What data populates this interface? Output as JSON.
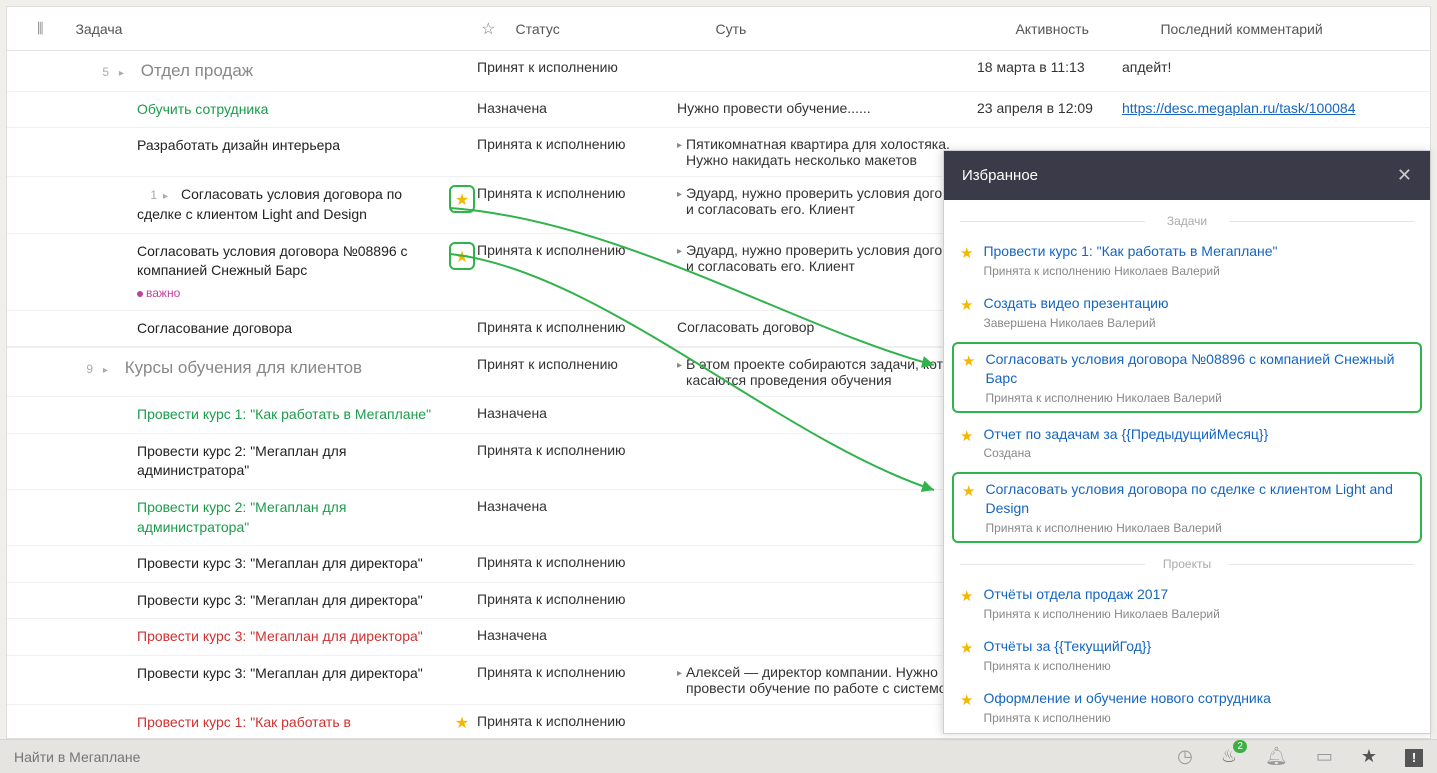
{
  "header": {
    "task": "Задача",
    "status": "Статус",
    "essence": "Суть",
    "activity": "Активность",
    "comment": "Последний комментарий"
  },
  "groups": [
    {
      "count": "5",
      "title": "Отдел продаж",
      "status": "Принят к исполнению",
      "activity": "18 марта в 11:13",
      "comment": "апдейт!"
    }
  ],
  "rows": [
    {
      "indent": 2,
      "title": "Обучить сотрудника",
      "color": "green",
      "status": "Назначена",
      "essence": "Нужно провести обучение......",
      "activity": "23 апреля в 12:09",
      "comment_link": "https://desc.megaplan.ru/task/100084"
    },
    {
      "indent": 2,
      "title": "Разработать дизайн интерьера",
      "color": "black",
      "status": "Принята к исполнению",
      "essence": "Пятикомнатная квартира для холостяка. Нужно накидать несколько макетов",
      "essence_tri": true
    },
    {
      "indent": 2,
      "count": "1",
      "caret": true,
      "title": "Согласовать условия договора по сделке с клиентом Light and Design",
      "color": "black",
      "star": true,
      "status": "Принята к исполнению",
      "essence": "Эдуард, нужно проверить условия договора и согласовать его. Клиент",
      "essence_tri": true
    },
    {
      "indent": 2,
      "title": "Согласовать условия договора №08896 с компанией Снежный Барс",
      "color": "black",
      "tag": "важно",
      "star": true,
      "status": "Принята к исполнению",
      "essence": "Эдуард, нужно проверить условия договора и согласовать его. Клиент",
      "essence_tri": true
    },
    {
      "indent": 2,
      "title": "Согласование договора",
      "color": "black",
      "status": "Принята к исполнению",
      "essence": "Согласовать договор"
    }
  ],
  "group2": {
    "count": "9",
    "title": "Курсы обучения для клиентов",
    "status": "Принят к исполнению",
    "essence": "В этом проекте собираются задачи, которые касаются проведения обучения",
    "essence_tri": true
  },
  "rows2": [
    {
      "title": "Провести курс 1: \"Как работать в Мегаплане\"",
      "color": "green",
      "status": "Назначена"
    },
    {
      "title": "Провести курс 2: \"Мегаплан для администратора\"",
      "color": "black",
      "status": "Принята к исполнению"
    },
    {
      "title": "Провести курс 2: \"Мегаплан для администратора\"",
      "color": "green",
      "status": "Назначена"
    },
    {
      "title": "Провести курс 3: \"Мегаплан для директора\"",
      "color": "black",
      "status": "Принята к исполнению"
    },
    {
      "title": "Провести курс 3: \"Мегаплан для директора\"",
      "color": "black",
      "status": "Принята к исполнению"
    },
    {
      "title": "Провести курс 3: \"Мегаплан для директора\"",
      "color": "red",
      "status": "Назначена"
    },
    {
      "title": "Провести курс 3: \"Мегаплан для директора\"",
      "color": "black",
      "status": "Принята к исполнению",
      "essence": "Алексей — директор компании. Нужно провести обучение по работе с системой",
      "essence_tri": true
    },
    {
      "title": "Провести курс 1: \"Как работать в",
      "color": "red",
      "star_small": true,
      "status": "Принята к исполнению"
    }
  ],
  "favorites": {
    "title": "Избранное",
    "section_tasks": "Задачи",
    "section_projects": "Проекты",
    "tasks": [
      {
        "title": "Провести курс 1: \"Как работать в Мегаплане\"",
        "meta": "Принята к исполнению Николаев Валерий"
      },
      {
        "title": "Создать видео презентацию",
        "meta": "Завершена Николаев Валерий"
      },
      {
        "title": "Согласовать условия договора №08896 с компанией Снежный Барс",
        "meta": "Принята к исполнению Николаев Валерий",
        "highlight": true
      },
      {
        "title": "Отчет по задачам за {{ПредыдущийМесяц}}",
        "meta": "Создана"
      },
      {
        "title": "Согласовать условия договора по сделке с клиентом Light and Design",
        "meta": "Принята к исполнению Николаев Валерий",
        "highlight": true
      }
    ],
    "projects": [
      {
        "title": "Отчёты отдела продаж 2017",
        "meta": "Принята к исполнению Николаев Валерий"
      },
      {
        "title": "Отчёты за {{ТекущийГод}}",
        "meta": "Принята к исполнению"
      },
      {
        "title": "Оформление и обучение нового сотрудника",
        "meta": "Принята к исполнению"
      }
    ]
  },
  "footer": {
    "search_placeholder": "Найти в Мегаплане",
    "fire_badge": "2"
  }
}
